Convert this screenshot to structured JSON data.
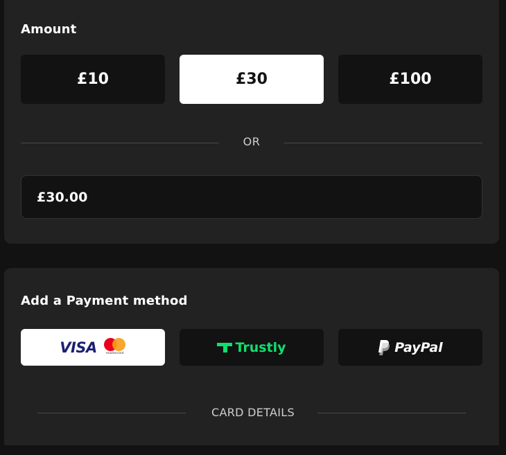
{
  "amount": {
    "title": "Amount",
    "options": [
      {
        "label": "£10",
        "selected": false
      },
      {
        "label": "£30",
        "selected": true
      },
      {
        "label": "£100",
        "selected": false
      }
    ],
    "or_label": "OR",
    "input_value": "£30.00"
  },
  "payment": {
    "title": "Add a Payment method",
    "methods": [
      {
        "name": "visa-mastercard",
        "visa_label": "VISA",
        "mastercard_label": "mastercard",
        "selected": true
      },
      {
        "name": "trustly",
        "label": "Trustly",
        "selected": false
      },
      {
        "name": "paypal",
        "label": "PayPal",
        "selected": false
      }
    ],
    "card_details_label": "CARD DETAILS"
  },
  "colors": {
    "background": "#121212",
    "panel": "#222222",
    "selected": "#ffffff",
    "trustly_green": "#0ee06e",
    "visa_blue": "#1a1f71",
    "mastercard_red": "#eb001b",
    "mastercard_yellow": "#f79e1b"
  }
}
